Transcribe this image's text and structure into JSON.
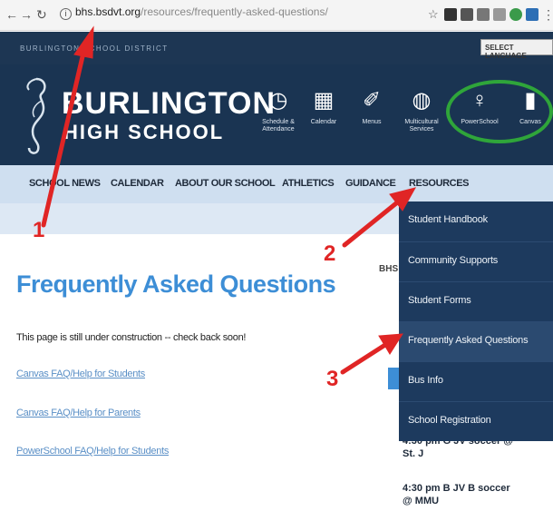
{
  "browser": {
    "url_host": "bhs.bsdvt.org",
    "url_path": "/resources/frequently-asked-questions/",
    "back_icon": "back-arrow-icon",
    "forward_icon": "forward-arrow-icon",
    "reload_icon": "reload-icon",
    "bookmark_icon": "star-icon"
  },
  "district": {
    "name": "BURLINGTON SCHOOL DISTRICT",
    "language_button": "SELECT LANGUAGE"
  },
  "header": {
    "school_line1": "BURLINGTON",
    "school_line2": "HIGH SCHOOL",
    "quick_links": [
      {
        "label": "Schedule & Attendance",
        "icon": "clock-icon"
      },
      {
        "label": "Calendar",
        "icon": "calendar-icon"
      },
      {
        "label": "Menus",
        "icon": "carrot-icon"
      },
      {
        "label": "Multicultural Services",
        "icon": "globe-icon"
      },
      {
        "label": "PowerSchool",
        "icon": "lightbulb-icon"
      },
      {
        "label": "Canvas",
        "icon": "book-icon"
      }
    ]
  },
  "nav": {
    "items": [
      "SCHOOL NEWS",
      "CALENDAR",
      "ABOUT OUR SCHOOL",
      "ATHLETICS",
      "GUIDANCE",
      "RESOURCES"
    ]
  },
  "dropdown": {
    "items": [
      "Student Handbook",
      "Community Supports",
      "Student Forms",
      "Frequently Asked Questions",
      "Bus Info",
      "School Registration"
    ]
  },
  "content": {
    "title": "Frequently Asked Questions",
    "intro": "This page is still under construction -- check back soon!",
    "links": [
      "Canvas FAQ/Help for Students",
      "Canvas FAQ/Help for Parents",
      "PowerSchool FAQ/Help for Students"
    ]
  },
  "sidebar": {
    "heading": "BHS",
    "events": [
      "4:30 pm G JV soccer @ St. J",
      "4:30 pm B JV B soccer @ MMU"
    ]
  },
  "annotations": {
    "labels": [
      "1",
      "2",
      "3"
    ],
    "arrow_color": "#e02525",
    "circle_color": "#2fa53a"
  },
  "colors": {
    "district_bar": "#1d3653",
    "header": "#1a3452",
    "nav": "#cfdff0",
    "title": "#3d8ed6",
    "dropdown": "#1d3a5e"
  }
}
